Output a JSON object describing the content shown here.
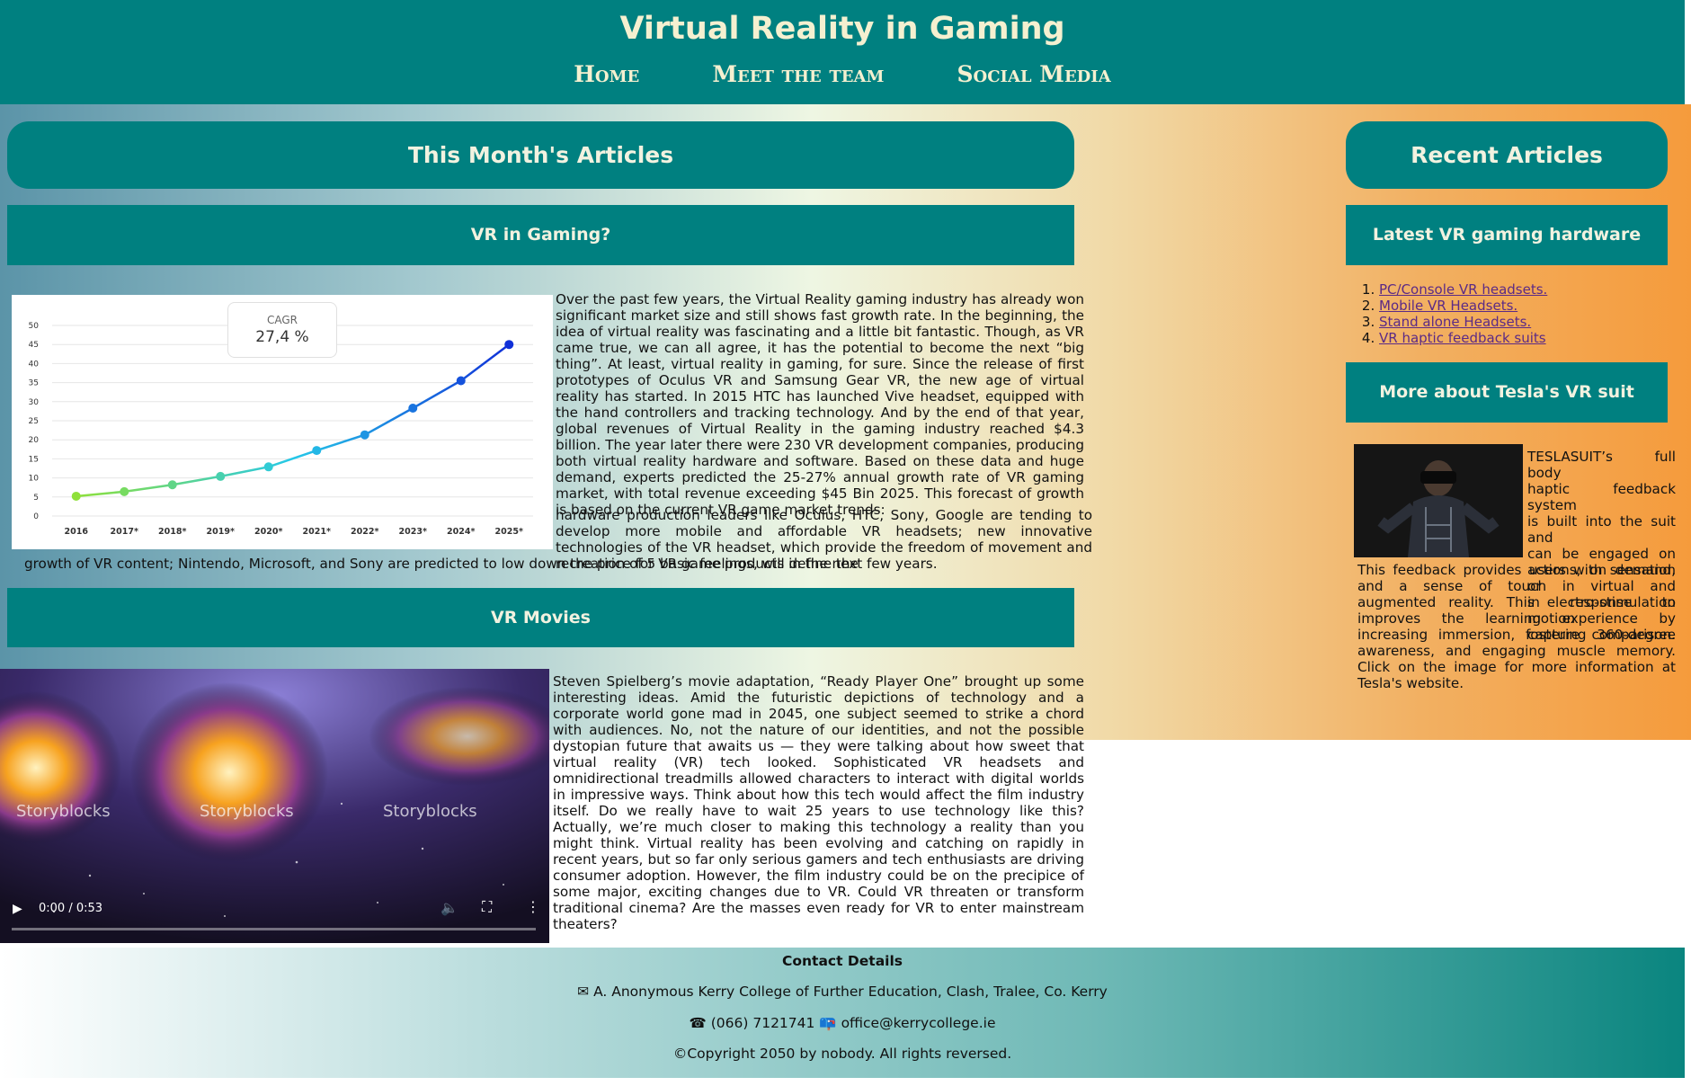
{
  "header": {
    "title": "Virtual Reality in Gaming",
    "nav": [
      "Home",
      "Meet the team",
      "Social Media"
    ]
  },
  "main": {
    "heading": "This Month's Articles",
    "sections": [
      {
        "title": "VR in Gaming?",
        "paragraph1": "Over the past few years, the Virtual Reality gaming industry has already won significant market size and still shows fast growth rate. In the beginning, the idea of virtual reality was fascinating and a little bit fantastic. Though, as VR came true, we can all agree, it has the potential to become the next “big thing”. At least, virtual reality in gaming, for sure. Since the release of first prototypes of Oculus VR and Samsung Gear VR, the new age of virtual reality has started. In 2015 HTC has launched Vive headset, equipped with the hand controllers and tracking technology. And by the end of that year, global revenues of Virtual Reality in the gaming industry reached $4.3 billion. The year later there were 230 VR development companies, producing both virtual reality hardware and software. Based on these data and huge demand, experts predicted the 25-27% annual growth rate of VR gaming market, with total revenue exceeding $45 Bin 2025. This forecast of growth is based on the current VR game market trends:",
        "paragraph2_part1": "hardware production leaders like Oculus, HTC, Sony, Google are tending to develop more mobile and affordable VR headsets; new innovative technologies of the VR headset, which provide the freedom of movement and recreation of 5 basic feelings, will define the",
        "paragraph2_part2": "growth of VR content; Nintendo, Microsoft, and Sony are predicted to low down the price for VR game products in the next few years."
      },
      {
        "title": "VR Movies",
        "paragraph": "Steven Spielberg’s movie adaptation, “Ready Player One” brought up some interesting ideas. Amid the futuristic depictions of technology and a corporate world gone mad in 2045, one subject seemed to strike a chord with audiences. No, not the nature of our identities, and not the possible dystopian future that awaits us — they were talking about how sweet that virtual reality (VR) tech looked. Sophisticated VR headsets and omnidirectional treadmills allowed characters to interact with digital worlds in impressive ways. Think about how this tech would affect the film industry itself. Do we really have to wait 25 years to use technology like this? Actually, we’re much closer to making this technology a reality than you might think. Virtual reality has been evolving and catching on rapidly in recent years, but so far only serious gamers and tech enthusiasts are driving consumer adoption. However, the film industry could be on the precipice of some major, exciting changes due to VR. Could VR threaten or transform traditional cinema? Are the masses even ready for VR to enter mainstream theaters?"
      }
    ]
  },
  "chart_data": {
    "type": "line",
    "categories": [
      "2016",
      "2017*",
      "2018*",
      "2019*",
      "2020*",
      "2021*",
      "2022*",
      "2023*",
      "2024*",
      "2025*"
    ],
    "values": [
      5.2,
      6.4,
      8.2,
      10.4,
      12.9,
      17.2,
      21.3,
      28.3,
      35.5,
      45
    ],
    "yticks": [
      0,
      5,
      10,
      15,
      20,
      25,
      30,
      35,
      40,
      45,
      50
    ],
    "ylim": [
      0,
      50
    ],
    "annotation": {
      "label": "CAGR",
      "value": "27,4 %"
    },
    "grid": true,
    "colors": {
      "start": "#8fe03a",
      "middle": "#25c8e8",
      "end": "#1030d8"
    }
  },
  "video": {
    "watermarks": [
      "Storyblocks",
      "Storyblocks",
      "Storyblocks"
    ],
    "time": "0:00 / 0:53"
  },
  "sidebar": {
    "heading": "Recent Articles",
    "hardware_title": "Latest VR gaming hardware",
    "links": [
      "PC/Console VR headsets.",
      "Mobile VR Headsets.",
      "Stand alone Headsets.",
      "VR haptic feedback suits"
    ],
    "tesla_title": "More about Tesla's VR suit",
    "tesla_text_lines": [
      "TESLASUIT’s full body",
      "haptic feedback system",
      "is built into the suit and",
      "can be engaged on",
      "actions, on demand, or",
      "in response to motion",
      "capture comparison."
    ],
    "tesla_text_rest": "This feedback provides users with sensation and a sense of touch in virtual and augmented reality. This electro-stimulation improves the learning experience by increasing immersion, fostering 360-degree awareness, and engaging muscle memory. Click on the image for more information at Tesla's website."
  },
  "footer": {
    "heading": "Contact Details",
    "address": "A. Anonymous Kerry College of Further Education, Clash, Tralee, Co. Kerry",
    "phone": "(066) 7121741",
    "email": "office@kerrycollege.ie",
    "copyright": "©Copyright 2050 by nobody. All rights reversed."
  },
  "colors": {
    "teal": "#008080",
    "cream": "#f5f0d0",
    "link": "#5b2a86"
  },
  "icons": {
    "address": "envelope-icon",
    "phone": "phone-icon",
    "email": "mailbox-icon"
  }
}
